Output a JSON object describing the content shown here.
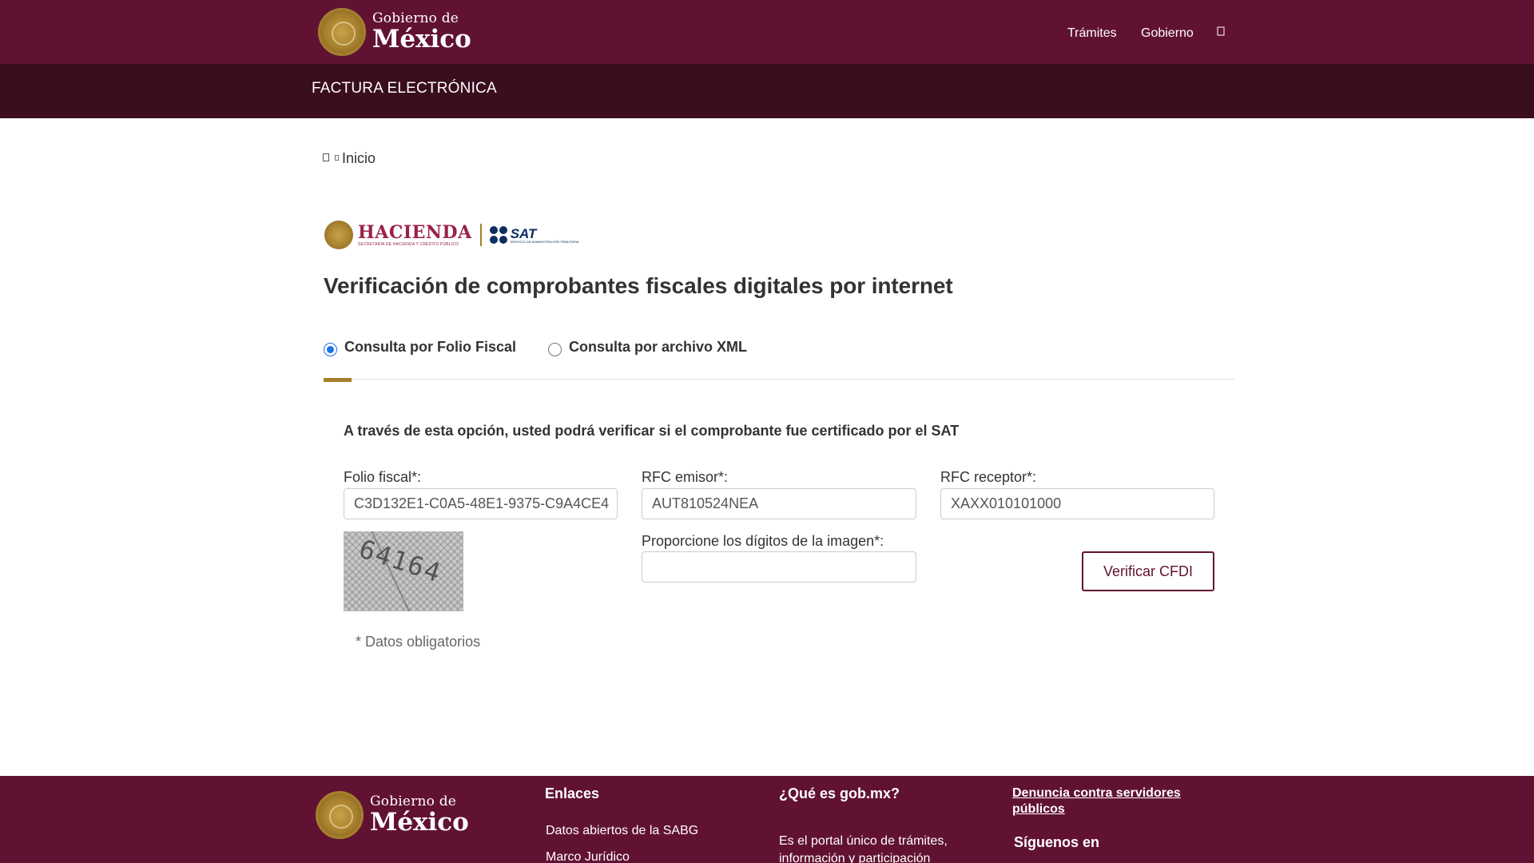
{
  "header": {
    "brand_small": "Gobierno de",
    "brand_big": "México",
    "nav": [
      "Trámites",
      "Gobierno"
    ],
    "search_icon": "search-icon"
  },
  "subheader": {
    "title": "FACTURA ELECTRÓNICA"
  },
  "breadcrumb": {
    "home_icon": "home-icon",
    "current": "Inicio"
  },
  "logos": {
    "hacienda_name": "HACIENDA",
    "hacienda_sub": "SECRETARÍA DE HACIENDA Y CRÉDITO PÚBLICO",
    "sat_name": "SAT",
    "sat_sub": "SERVICIO DE ADMINISTRACIÓN TRIBUTARIA"
  },
  "page": {
    "title": "Verificación de comprobantes fiscales digitales por internet",
    "options": [
      {
        "label": "Consulta por Folio Fiscal",
        "selected": true
      },
      {
        "label": "Consulta por archivo XML",
        "selected": false
      }
    ],
    "intro": "A través de esta opción, usted podrá verificar si el comprobante fue certificado por el SAT"
  },
  "form": {
    "folio_label": "Folio fiscal*:",
    "folio_value": "C3D132E1-C0A5-48E1-9375-C9A4CE4",
    "rfc_emisor_label": "RFC emisor*:",
    "rfc_emisor_value": "AUT810524NEA",
    "rfc_receptor_label": "RFC receptor*:",
    "rfc_receptor_value": "XAXX010101000",
    "captcha_label": "Proporcione los dígitos de la imagen*:",
    "captcha_value": "",
    "captcha_image_text": "64164",
    "verify_label": "Verificar CFDI",
    "required_note": "* Datos obligatorios"
  },
  "footer": {
    "brand_small": "Gobierno de",
    "brand_big": "México",
    "links_heading": "Enlaces",
    "links": [
      "Datos abiertos de la SABG",
      "Marco Jurídico"
    ],
    "about_heading": "¿Qué es gob.mx?",
    "about_text": "Es el portal único de trámites, información y participación",
    "denuncia": "Denuncia contra servidores públicos",
    "follow": "Síguenos en"
  },
  "colors": {
    "primary": "#611232",
    "dark": "#3a0d1f",
    "gold": "#a57f2c",
    "radio": "#1a73e8"
  }
}
